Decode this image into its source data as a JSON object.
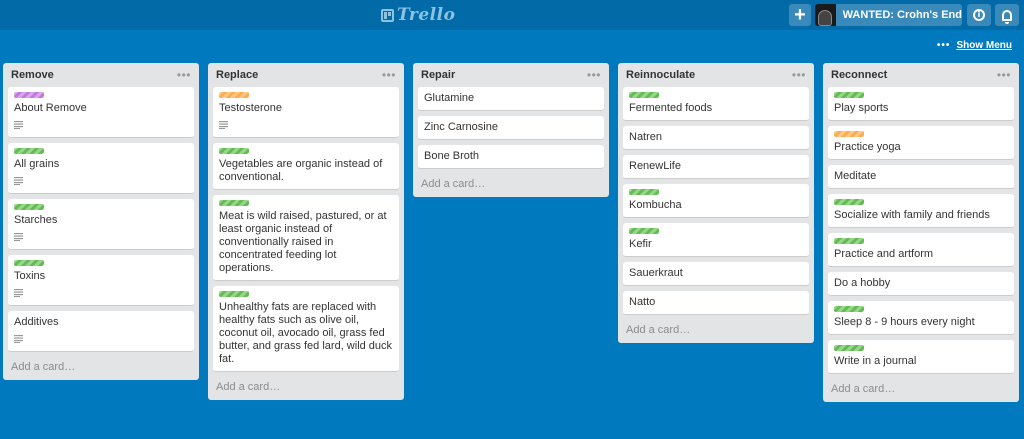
{
  "header": {
    "logo": "Trello",
    "add_label": "+",
    "member_name": "WANTED: Crohn's End"
  },
  "board": {
    "show_menu": "Show Menu",
    "show_menu_dots": "•••"
  },
  "add_card_label": "Add a card…",
  "list_menu_glyph": "•••",
  "lists": [
    {
      "title": "Remove",
      "cards": [
        {
          "label": "purple",
          "title": "About Remove",
          "has_description": true
        },
        {
          "label": "green",
          "title": "All grains",
          "has_description": true
        },
        {
          "label": "green",
          "title": "Starches",
          "has_description": true
        },
        {
          "label": "green",
          "title": "Toxins",
          "has_description": true
        },
        {
          "label": "",
          "title": "Additives",
          "has_description": true
        }
      ]
    },
    {
      "title": "Replace",
      "cards": [
        {
          "label": "orange",
          "title": "Testosterone",
          "has_description": true
        },
        {
          "label": "green",
          "title": "Vegetables are organic instead of conventional.",
          "has_description": false
        },
        {
          "label": "green",
          "title": "Meat is wild raised, pastured, or at least organic instead of conventionally raised in concentrated feeding lot operations.",
          "has_description": false
        },
        {
          "label": "green",
          "title": "Unhealthy fats are replaced with healthy fats such as olive oil, coconut oil, avocado oil, grass fed butter, and grass fed lard, wild duck fat.",
          "has_description": false
        }
      ]
    },
    {
      "title": "Repair",
      "cards": [
        {
          "label": "",
          "title": "Glutamine",
          "has_description": false
        },
        {
          "label": "",
          "title": "Zinc Carnosine",
          "has_description": false
        },
        {
          "label": "",
          "title": "Bone Broth",
          "has_description": false
        }
      ]
    },
    {
      "title": "Reinnoculate",
      "cards": [
        {
          "label": "green",
          "title": "Fermented foods",
          "has_description": false
        },
        {
          "label": "",
          "title": "Natren",
          "has_description": false
        },
        {
          "label": "",
          "title": "RenewLife",
          "has_description": false
        },
        {
          "label": "green",
          "title": "Kombucha",
          "has_description": false
        },
        {
          "label": "green",
          "title": "Kefir",
          "has_description": false
        },
        {
          "label": "",
          "title": "Sauerkraut",
          "has_description": false
        },
        {
          "label": "",
          "title": "Natto",
          "has_description": false
        }
      ]
    },
    {
      "title": "Reconnect",
      "cards": [
        {
          "label": "green",
          "title": "Play sports",
          "has_description": false
        },
        {
          "label": "orange",
          "title": "Practice yoga",
          "has_description": false
        },
        {
          "label": "",
          "title": "Meditate",
          "has_description": false
        },
        {
          "label": "green",
          "title": "Socialize with family and friends",
          "has_description": false
        },
        {
          "label": "green",
          "title": "Practice and artform",
          "has_description": false
        },
        {
          "label": "",
          "title": "Do a hobby",
          "has_description": false
        },
        {
          "label": "green",
          "title": "Sleep 8 - 9 hours every night",
          "has_description": false
        },
        {
          "label": "green",
          "title": "Write in a journal",
          "has_description": false
        }
      ]
    }
  ],
  "colors": {
    "board_background": "#0079bf",
    "header_background": "#026aa7",
    "list_background": "#e2e4e6",
    "label_green": "#61bd4f",
    "label_orange": "#ffab4a",
    "label_purple": "#c377e0"
  }
}
